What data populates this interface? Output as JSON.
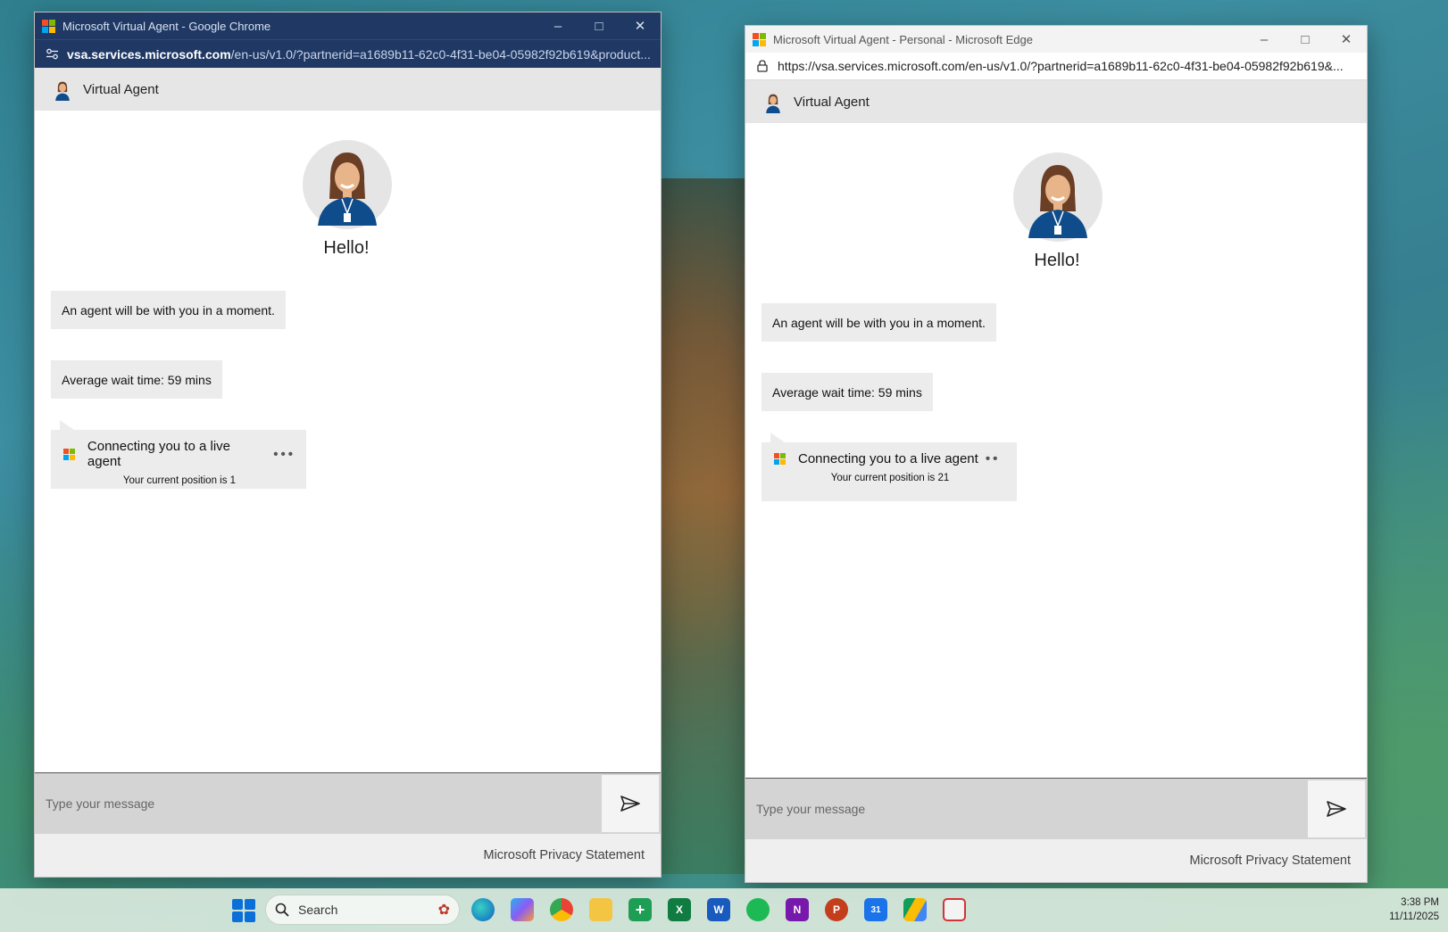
{
  "chrome": {
    "title": "Microsoft Virtual Agent - Google Chrome",
    "url_host": "vsa.services.microsoft.com",
    "url_rest": "/en-us/v1.0/?partnerid=a1689b11-62c0-4f31-be04-05982f92b619&product..."
  },
  "edge": {
    "title": "Microsoft Virtual Agent - Personal - Microsoft Edge",
    "url": "https://vsa.services.microsoft.com/en-us/v1.0/?partnerid=a1689b11-62c0-4f31-be04-05982f92b619&..."
  },
  "chat_left": {
    "header": "Virtual Agent",
    "greeting": "Hello!",
    "messages": [
      "An agent will be with you in a moment.",
      "Average wait time: 59 mins"
    ],
    "status": "Connecting you to a live agent",
    "position": "Your current position is 1",
    "input_placeholder": "Type your message",
    "footer": "Microsoft Privacy Statement"
  },
  "chat_right": {
    "header": "Virtual Agent",
    "greeting": "Hello!",
    "messages": [
      "An agent will be with you in a moment.",
      "Average wait time: 59 mins"
    ],
    "status": "Connecting you to a live agent",
    "position": "Your current position is 21",
    "input_placeholder": "Type your message",
    "footer": "Microsoft Privacy Statement"
  },
  "taskbar": {
    "search_label": "Search",
    "time": "3:38 PM",
    "date": "11/11/2025",
    "icons": [
      "windows-start-icon",
      "edge-icon",
      "copilot-icon",
      "chrome-icon",
      "file-explorer-icon",
      "google-sheets-icon",
      "excel-icon",
      "word-icon",
      "spotify-icon",
      "onenote-icon",
      "powerpoint-icon",
      "calendar-icon",
      "google-drive-icon",
      "snipping-tool-icon"
    ]
  },
  "colors": {
    "chrome_titlebar": "#1f3864",
    "bubble": "#ececec",
    "chat_header": "#e6e6e6"
  }
}
